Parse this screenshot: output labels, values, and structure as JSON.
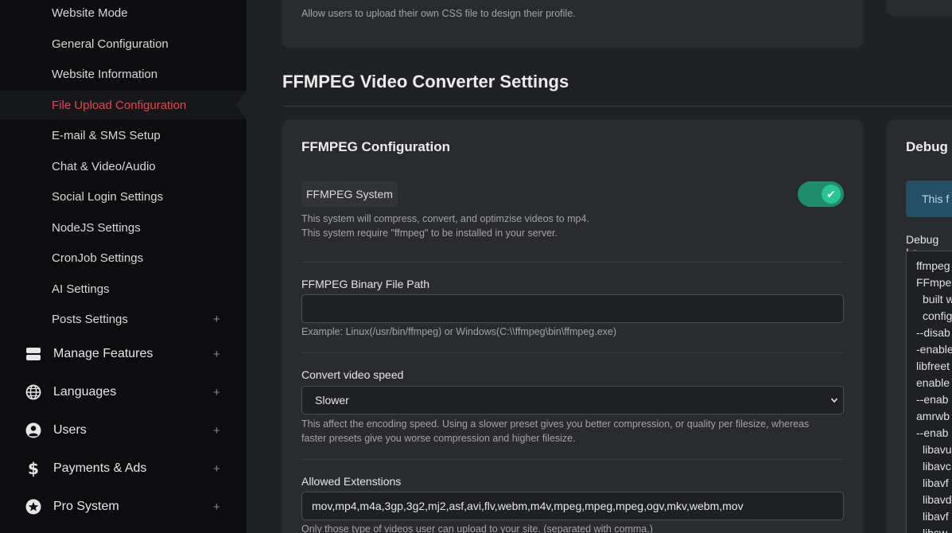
{
  "sidebar": {
    "sub_items": [
      {
        "label": "Website Mode",
        "active": false
      },
      {
        "label": "General Configuration",
        "active": false
      },
      {
        "label": "Website Information",
        "active": false
      },
      {
        "label": "File Upload Configuration",
        "active": true
      },
      {
        "label": "E-mail & SMS Setup",
        "active": false
      },
      {
        "label": "Chat & Video/Audio",
        "active": false
      },
      {
        "label": "Social Login Settings",
        "active": false
      },
      {
        "label": "NodeJS Settings",
        "active": false
      },
      {
        "label": "CronJob Settings",
        "active": false
      },
      {
        "label": "AI Settings",
        "active": false
      },
      {
        "label": "Posts Settings",
        "active": false,
        "expandable": true
      }
    ],
    "main_items": [
      {
        "label": "Manage Features",
        "icon": "features-icon"
      },
      {
        "label": "Languages",
        "icon": "globe-icon"
      },
      {
        "label": "Users",
        "icon": "user-icon"
      },
      {
        "label": "Payments & Ads",
        "icon": "dollar-icon"
      },
      {
        "label": "Pro System",
        "icon": "star-icon"
      }
    ],
    "plus_glyph": "+"
  },
  "top_card": {
    "description": "Allow users to upload their own CSS file to design their profile."
  },
  "section": {
    "title": "FFMPEG Video Converter Settings"
  },
  "ffmpeg": {
    "title": "FFMPEG Configuration",
    "system_label": "FFMPEG System",
    "system_enabled": true,
    "system_desc_1": "This system will compress, convert, and optimzise videos to mp4.",
    "system_desc_2": "This system require \"ffmpeg\" to be installed in your server.",
    "binary_label": "FFMPEG Binary File Path",
    "binary_value": "",
    "binary_hint": "Example: Linux(/usr/bin/ffmpeg) or Windows(C:\\\\ffmpeg\\bin\\ffmpeg.exe)",
    "speed_label": "Convert video speed",
    "speed_value": "Slower",
    "speed_hint_1": "This affect the encoding speed. Using a slower preset gives you better compression, or quality per filesize, whereas",
    "speed_hint_2": "faster presets give you worse compression and higher filesize.",
    "ext_label": "Allowed Extenstions",
    "ext_value": "mov,mp4,m4a,3gp,3g2,mj2,asf,avi,flv,webm,m4v,mpeg,mpeg,mpeg,ogv,mkv,webm,mov",
    "ext_hint": "Only those type of videos user can upload to your site. (separated with comma.)"
  },
  "debug": {
    "title": "Debug",
    "info": "This f",
    "log_label": "Debug Lo",
    "log_lines": [
      "ffmpeg",
      "FFmpe",
      "  built w",
      "  config",
      "--disab",
      "-enable",
      "libfreet",
      "enable",
      "--enab",
      "amrwb",
      "--enab",
      "  libavu",
      "  libavc",
      "  libavf",
      "  libavd",
      "  libavf",
      "  libsw"
    ]
  },
  "colors": {
    "accent_active": "#e9444c",
    "toggle_on": "#29c48f",
    "info_bg": "#255064"
  }
}
